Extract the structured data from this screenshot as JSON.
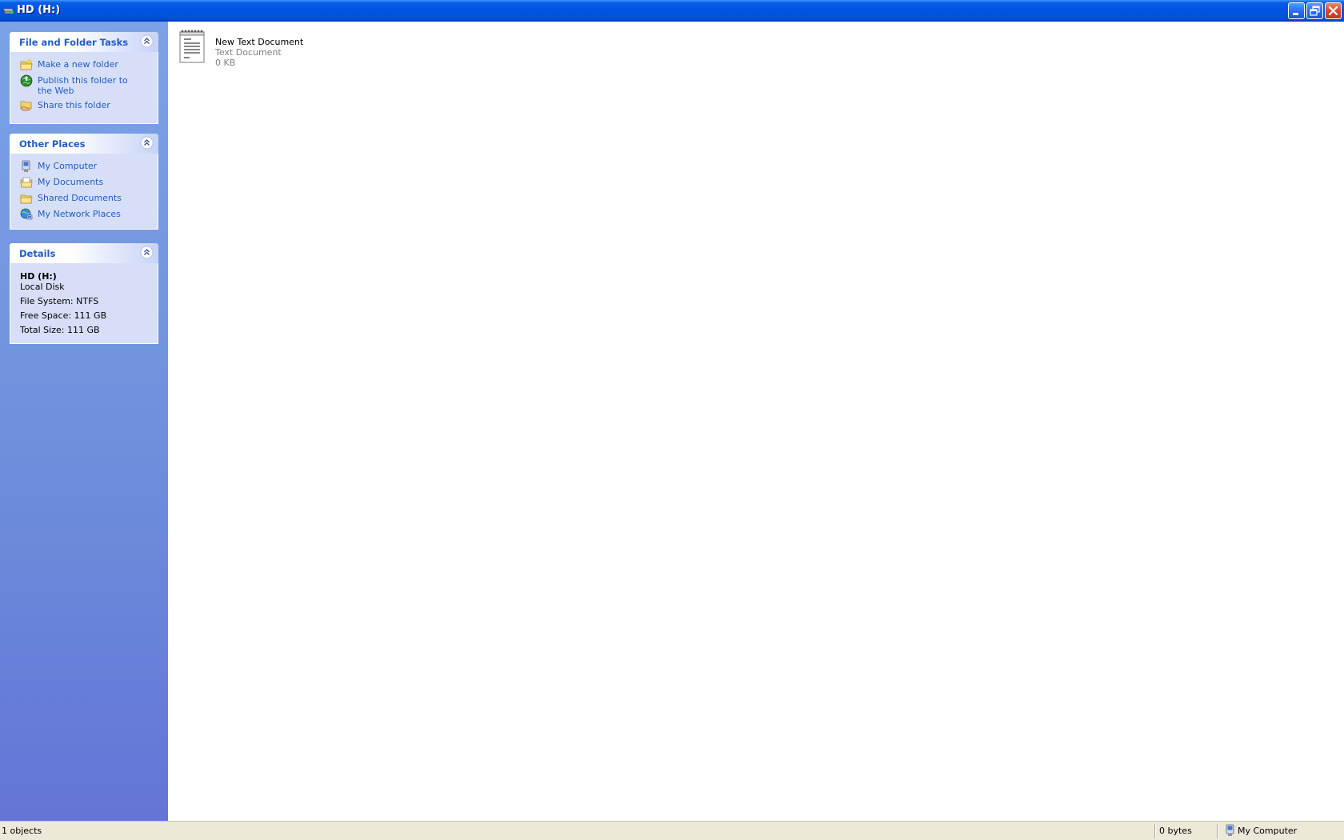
{
  "window": {
    "title": "HD (H:)"
  },
  "sidebar": {
    "tasks_panel": {
      "title": "File and Folder Tasks",
      "items": [
        {
          "label": "Make a new folder",
          "icon": "new-folder-icon"
        },
        {
          "label": "Publish this folder to the Web",
          "icon": "publish-web-icon"
        },
        {
          "label": "Share this folder",
          "icon": "share-folder-icon"
        }
      ]
    },
    "places_panel": {
      "title": "Other Places",
      "items": [
        {
          "label": "My Computer",
          "icon": "my-computer-icon"
        },
        {
          "label": "My Documents",
          "icon": "my-documents-icon"
        },
        {
          "label": "Shared Documents",
          "icon": "shared-documents-icon"
        },
        {
          "label": "My Network Places",
          "icon": "network-places-icon"
        }
      ]
    },
    "details_panel": {
      "title": "Details",
      "name": "HD (H:)",
      "type": "Local Disk",
      "file_system": "File System: NTFS",
      "free_space": "Free Space: 111 GB",
      "total_size": "Total Size: 111 GB"
    }
  },
  "content": {
    "files": [
      {
        "name": "New Text Document",
        "type": "Text Document",
        "size": "0 KB",
        "icon": "text-document-icon"
      }
    ]
  },
  "statusbar": {
    "objects": "1 objects",
    "size": "0 bytes",
    "location": "My Computer"
  },
  "colors": {
    "titlebar": "#0054e3",
    "sidebar_top": "#7ba2e7",
    "sidebar_bottom": "#6375d6",
    "link": "#215dc6",
    "panel_body": "#d6dff7"
  }
}
